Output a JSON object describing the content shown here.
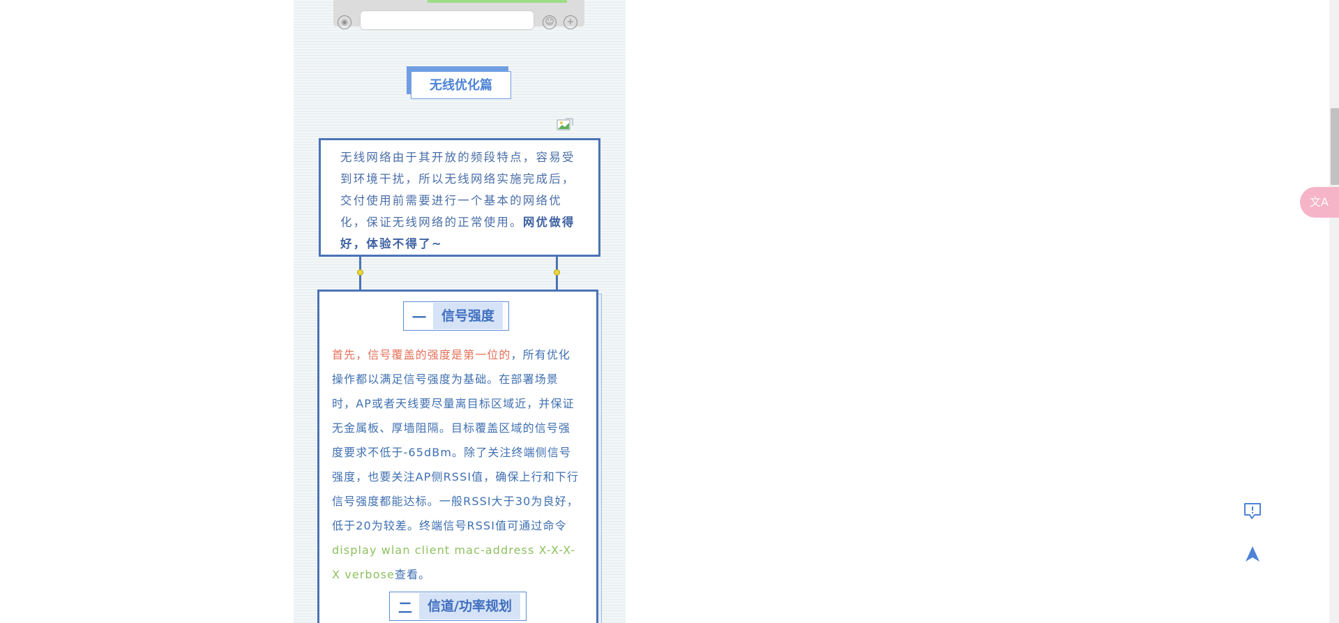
{
  "article": {
    "title": "无线优化篇",
    "intro": {
      "text": "无线网络由于其开放的频段特点，容易受到环境干扰，所以无线网络实施完成后，交付使用前需要进行一个基本的网络优化，保证无线网络的正常使用。",
      "bold": "网优做得好，体验不得了~"
    },
    "section1": {
      "number": "一",
      "heading": "信号强度",
      "highlight": "首先，信号覆盖的强度是第一位的",
      "text": "，所有优化操作都以满足信号强度为基础。在部署场景时，AP或者天线要尽量离目标区域近，并保证无金属板、厚墙阻隔。目标覆盖区域的信号强度要求不低于-65dBm。除了关注终端侧信号强度，也要关注AP侧RSSI值，确保上行和下行信号强度都能达标。一般RSSI大于30为良好，低于20为较差。终端信号RSSI值可通过命令",
      "command": "display wlan client mac-address X-X-X-X verbose",
      "suffix": "查看。"
    },
    "section2": {
      "number": "二",
      "heading": "信道/功率规划"
    }
  },
  "tools": {
    "translate_label": "文A",
    "feedback_icon": "feedback-icon",
    "top_icon": "back-to-top-icon"
  },
  "colors": {
    "accent_blue": "#4a73b6",
    "heading_blue": "#3f6fbf",
    "highlight_red": "#e5705a",
    "command_green": "#8dc05e"
  }
}
